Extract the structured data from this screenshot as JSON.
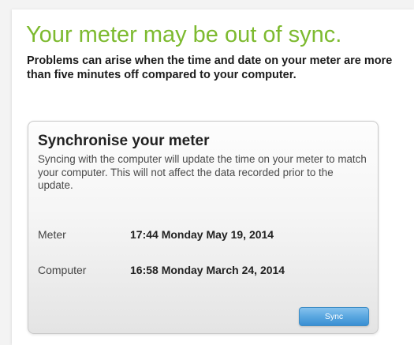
{
  "header": {
    "title": "Your meter may be out of sync.",
    "warning": "Problems can arise when the time and date on your meter are more than five minutes off compared to your computer."
  },
  "sync_panel": {
    "title": "Synchronise your meter",
    "description": "Syncing with the computer will update the time on your meter to match your computer.  This will not affect the data recorded prior to the update.",
    "meter_label": "Meter",
    "meter_time": "17:44 Monday May 19, 2014",
    "computer_label": "Computer",
    "computer_time": "16:58 Monday March 24, 2014",
    "sync_button_label": "Sync"
  },
  "colors": {
    "headline_green": "#7dba2f",
    "button_blue": "#5aa7e0"
  }
}
